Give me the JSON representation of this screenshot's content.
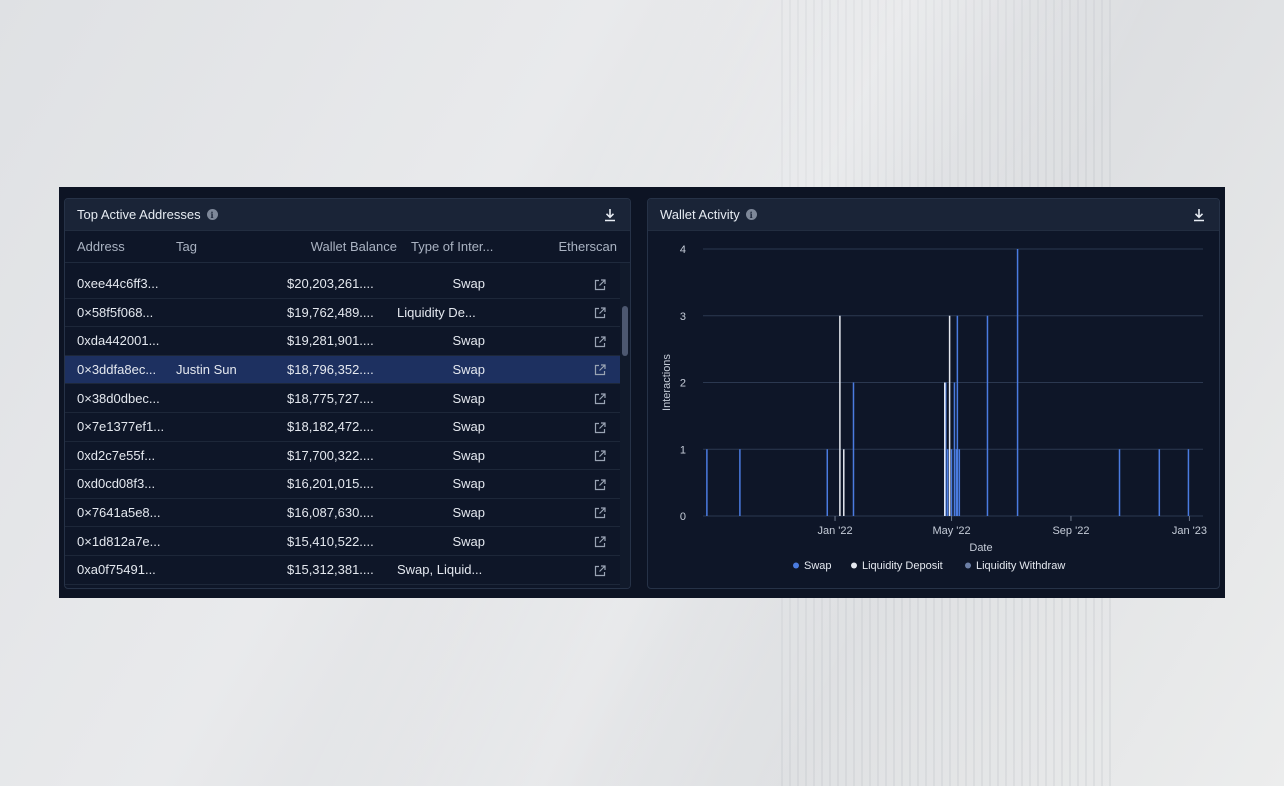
{
  "left_panel": {
    "title": "Top Active Addresses",
    "columns": [
      "Address",
      "Tag",
      "Wallet Balance",
      "Type of Inter...",
      "Etherscan"
    ],
    "rows": [
      {
        "address": "0xee44c6ff3...",
        "tag": "",
        "balance": "$20,203,261....",
        "type": "Swap",
        "selected": false
      },
      {
        "address": "0×58f5f068...",
        "tag": "",
        "balance": "$19,762,489....",
        "type": "Liquidity De...",
        "selected": false
      },
      {
        "address": "0xda442001...",
        "tag": "",
        "balance": "$19,281,901....",
        "type": "Swap",
        "selected": false
      },
      {
        "address": "0×3ddfa8ec...",
        "tag": "Justin Sun",
        "balance": "$18,796,352....",
        "type": "Swap",
        "selected": true
      },
      {
        "address": "0×38d0dbec...",
        "tag": "",
        "balance": "$18,775,727....",
        "type": "Swap",
        "selected": false
      },
      {
        "address": "0×7e1377ef1...",
        "tag": "",
        "balance": "$18,182,472....",
        "type": "Swap",
        "selected": false
      },
      {
        "address": "0xd2c7e55f...",
        "tag": "",
        "balance": "$17,700,322....",
        "type": "Swap",
        "selected": false
      },
      {
        "address": "0xd0cd08f3...",
        "tag": "",
        "balance": "$16,201,015....",
        "type": "Swap",
        "selected": false
      },
      {
        "address": "0×7641a5e8...",
        "tag": "",
        "balance": "$16,087,630....",
        "type": "Swap",
        "selected": false
      },
      {
        "address": "0×1d812a7e...",
        "tag": "",
        "balance": "$15,410,522....",
        "type": "Swap",
        "selected": false
      },
      {
        "address": "0xa0f75491...",
        "tag": "",
        "balance": "$15,312,381....",
        "type": "Swap, Liquid...",
        "selected": false
      }
    ],
    "icons": {
      "info": "info-icon",
      "download": "download-icon",
      "external": "external-link-icon"
    }
  },
  "right_panel": {
    "title": "Wallet Activity",
    "icons": {
      "info": "info-icon",
      "download": "download-icon"
    }
  },
  "chart_data": {
    "type": "bar",
    "title": "",
    "xlabel": "Date",
    "ylabel": "Interactions",
    "ylim": [
      0,
      4
    ],
    "yticks": [
      "0",
      "1",
      "2",
      "3",
      "4"
    ],
    "xticks": [
      "Jan '22",
      "May '22",
      "Sep '22",
      "Jan '23"
    ],
    "xtick_dates": [
      "2022-01-01",
      "2022-05-01",
      "2022-09-01",
      "2023-01-01"
    ],
    "xlim": [
      "2021-08-18",
      "2023-01-15"
    ],
    "grid": true,
    "legend_position": "bottom",
    "series": [
      {
        "name": "Swap",
        "color": "#4a7be0",
        "points": [
          {
            "date": "2021-08-22",
            "value": 1
          },
          {
            "date": "2021-09-25",
            "value": 1
          },
          {
            "date": "2021-12-24",
            "value": 1
          },
          {
            "date": "2022-01-20",
            "value": 2
          },
          {
            "date": "2022-04-25",
            "value": 2
          },
          {
            "date": "2022-04-27",
            "value": 1
          },
          {
            "date": "2022-05-01",
            "value": 1
          },
          {
            "date": "2022-05-04",
            "value": 2
          },
          {
            "date": "2022-05-06",
            "value": 1
          },
          {
            "date": "2022-05-07",
            "value": 3
          },
          {
            "date": "2022-05-09",
            "value": 1
          },
          {
            "date": "2022-06-07",
            "value": 3
          },
          {
            "date": "2022-07-08",
            "value": 4
          },
          {
            "date": "2022-10-21",
            "value": 1
          },
          {
            "date": "2022-12-01",
            "value": 1
          },
          {
            "date": "2022-12-31",
            "value": 1
          }
        ]
      },
      {
        "name": "Liquidity Deposit",
        "color": "#e4e8ef",
        "points": [
          {
            "date": "2022-01-06",
            "value": 3
          },
          {
            "date": "2022-01-10",
            "value": 1
          },
          {
            "date": "2022-04-24",
            "value": 2
          },
          {
            "date": "2022-04-29",
            "value": 3
          }
        ]
      },
      {
        "name": "Liquidity Withdraw",
        "color": "#6c7fa6",
        "points": []
      }
    ]
  }
}
